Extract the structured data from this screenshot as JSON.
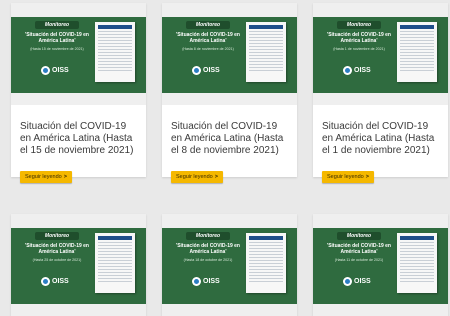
{
  "colors": {
    "page_background": "#e9e9e9",
    "card_background": "#ffffff",
    "thumbnail_green": "#2f6b3f",
    "button_yellow": "#f5b800"
  },
  "button_label": "Seguir leyendo",
  "button_icon": "chevron-right-icon",
  "cards": [
    {
      "title": "Situación del COVID-19 en América Latina (Hasta el 15 de noviembre 2021)",
      "thumbnail": {
        "badge": "Monitoreo",
        "headline": "'Situación del COVID-19 en América Latina'",
        "date": "(Hasta 15 de noviembre de 2021)",
        "logo": "OISS"
      }
    },
    {
      "title": "Situación del COVID-19 en América Latina (Hasta el 8 de noviembre 2021)",
      "thumbnail": {
        "badge": "Monitoreo",
        "headline": "'Situación del COVID-19 en América Latina'",
        "date": "(Hasta 8 de noviembre de 2021)",
        "logo": "OISS"
      }
    },
    {
      "title": "Situación del COVID-19 en América Latina (Hasta el 1 de noviembre 2021)",
      "thumbnail": {
        "badge": "Monitoreo",
        "headline": "'Situación del COVID-19 en América Latina'",
        "date": "(Hasta 1 de noviembre de 2021)",
        "logo": "OISS"
      }
    },
    {
      "title": "",
      "thumbnail": {
        "badge": "Monitoreo",
        "headline": "'Situación del COVID-19 en América Latina'",
        "date": "(Hasta 25 de octubre de 2021)",
        "logo": "OISS"
      }
    },
    {
      "title": "",
      "thumbnail": {
        "badge": "Monitoreo",
        "headline": "'Situación del COVID-19 en América Latina'",
        "date": "(Hasta 18 de octubre de 2021)",
        "logo": "OISS"
      }
    },
    {
      "title": "",
      "thumbnail": {
        "badge": "Monitoreo",
        "headline": "'Situación del COVID-19 en América Latina'",
        "date": "(Hasta 11 de octubre de 2021)",
        "logo": "OISS"
      }
    }
  ]
}
